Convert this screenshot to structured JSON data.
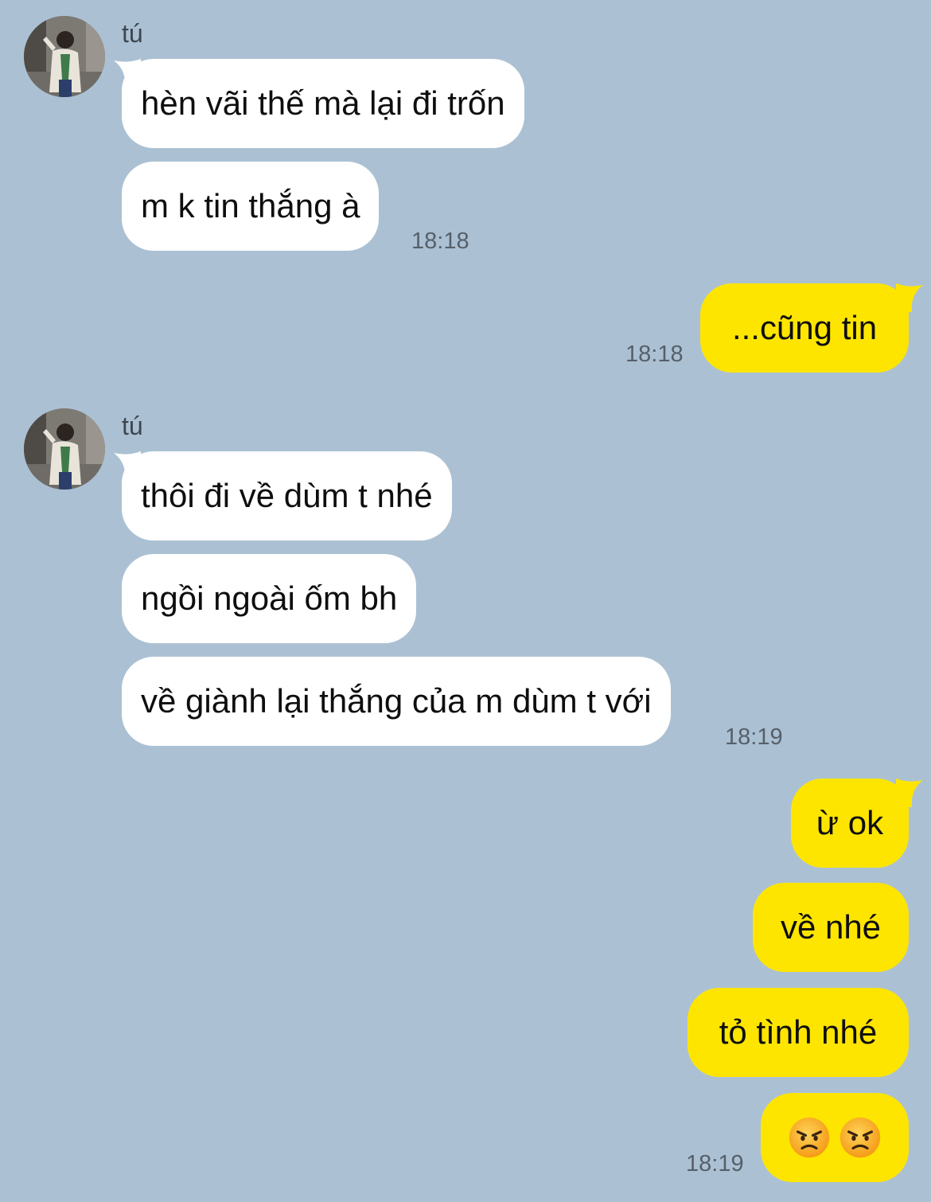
{
  "chat": {
    "groups": [
      {
        "sender": "tú",
        "messages": [
          "hèn vãi thế mà lại đi trốn",
          "m k tin thắng à"
        ],
        "time": "18:18"
      },
      {
        "self": true,
        "messages": [
          "...cũng tin"
        ],
        "time": "18:18"
      },
      {
        "sender": "tú",
        "messages": [
          "thôi đi về dùm t nhé",
          "ngồi ngoài ốm bh",
          "về giành lại thắng của m dùm t với"
        ],
        "time": "18:19"
      },
      {
        "self": true,
        "messages": [
          "ừ ok",
          "về nhé",
          "tỏ tình nhé"
        ],
        "emoji_message": [
          "angry-face-emoji",
          "angry-face-emoji"
        ],
        "time": "18:19"
      }
    ]
  },
  "colors": {
    "background": "#abc1d3",
    "incoming_bubble": "#ffffff",
    "outgoing_bubble": "#fee500"
  }
}
